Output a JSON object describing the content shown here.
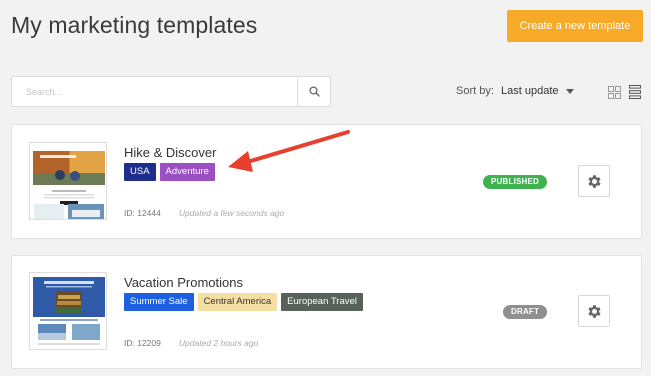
{
  "page": {
    "title": "My marketing templates",
    "create_button": "Create a new template"
  },
  "toolbar": {
    "search_placeholder": "Search...",
    "sort_label": "Sort by:",
    "sort_value": "Last update"
  },
  "colors": {
    "accent": "#f7a928",
    "published": "#3fb24f",
    "draft": "#8f8f8f",
    "annotation_arrow": "#e8402e"
  },
  "templates": [
    {
      "title": "Hike & Discover",
      "tags": [
        {
          "label": "USA",
          "color": "#1f2e8c",
          "text_color": "#ffffff"
        },
        {
          "label": "Adventure",
          "color": "#9b4fc2",
          "text_color": "#ffffff"
        }
      ],
      "id_text": "ID: 12444",
      "updated": "Updated a few seconds ago",
      "status": "PUBLISHED"
    },
    {
      "title": "Vacation Promotions",
      "tags": [
        {
          "label": "Summer Sale",
          "color": "#1d5fe0",
          "text_color": "#ffffff"
        },
        {
          "label": "Central America",
          "color": "#f6dfa5",
          "text_color": "#333333"
        },
        {
          "label": "European Travel",
          "color": "#56625a",
          "text_color": "#ffffff"
        }
      ],
      "id_text": "ID: 12209",
      "updated": "Updated 2 hours ago",
      "status": "DRAFT"
    }
  ]
}
